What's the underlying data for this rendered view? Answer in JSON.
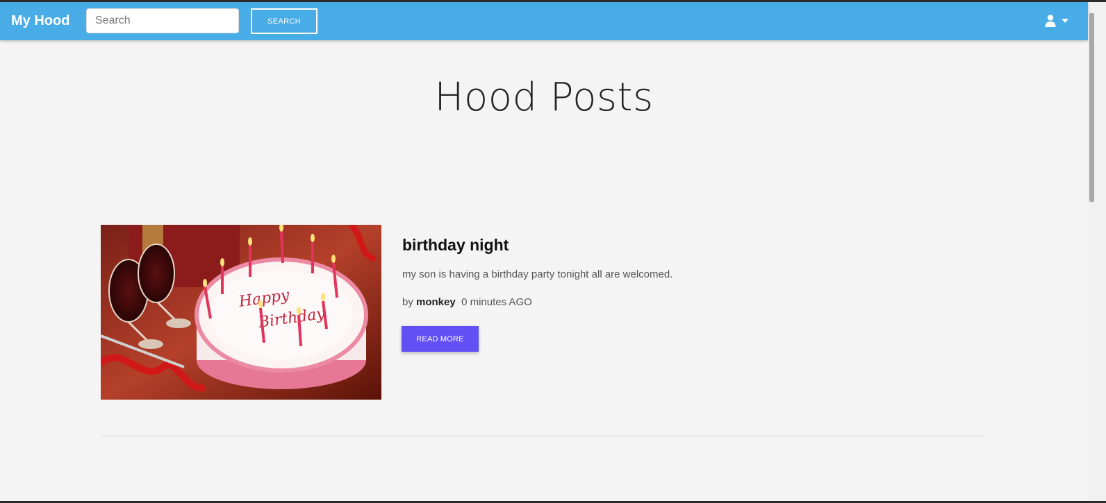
{
  "navbar": {
    "brand": "My Hood",
    "search_placeholder": "Search",
    "search_button_label": "SEARCH",
    "user_icon": "user-icon",
    "dropdown_icon": "caret-down-icon",
    "background_color": "#48ace7"
  },
  "page": {
    "title": "Hood Posts"
  },
  "posts": [
    {
      "image_subject": "birthday cake with candles and wine glasses",
      "image_text": "Happy Birthday",
      "title": "birthday night",
      "excerpt": "my son is having a birthday party tonight all are welcomed.",
      "by_label": "by",
      "author": "monkey",
      "time_ago": "0 minutes AGO",
      "read_more_label": "READ MORE",
      "button_color": "#6350f5"
    }
  ]
}
